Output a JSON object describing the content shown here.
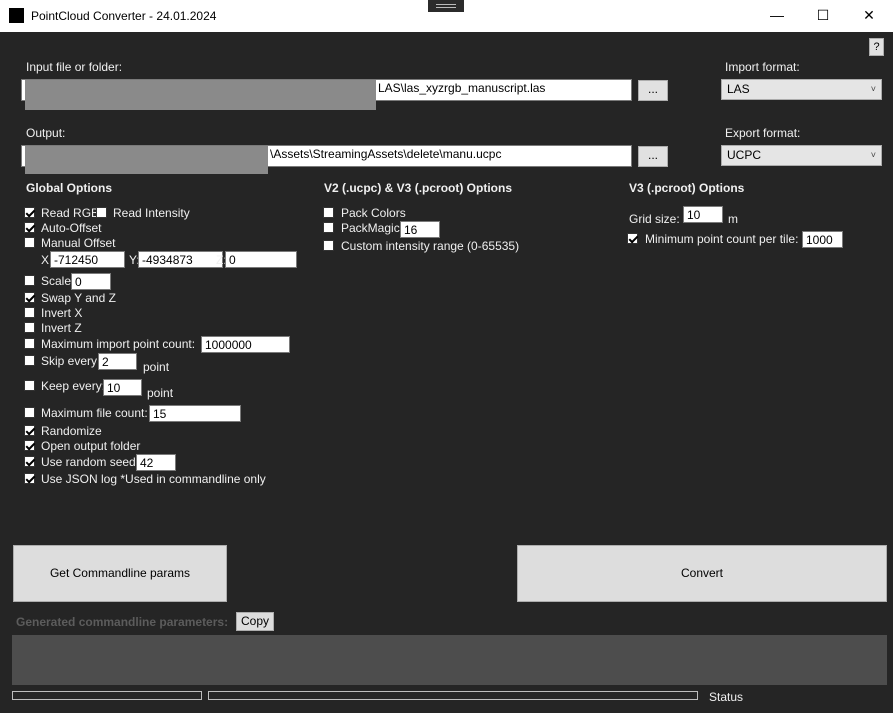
{
  "window": {
    "title": "PointCloud Converter - 24.01.2024",
    "minimize": "—",
    "maximize": "☐",
    "close": "✕"
  },
  "help_button": "?",
  "input": {
    "label": "Input file or folder:",
    "path_visible": "LAS\\las_xyzrgb_manuscript.las",
    "browse": "..."
  },
  "output": {
    "label": "Output:",
    "path_visible": "\\Assets\\StreamingAssets\\delete\\manu.ucpc",
    "browse": "..."
  },
  "import_format": {
    "label": "Import format:",
    "value": "LAS"
  },
  "export_format": {
    "label": "Export format:",
    "value": "UCPC"
  },
  "global_options": {
    "title": "Global Options",
    "read_rgb": {
      "label": "Read RGB",
      "checked": true
    },
    "read_intensity": {
      "label": "Read Intensity",
      "checked": false
    },
    "auto_offset": {
      "label": "Auto-Offset",
      "checked": true
    },
    "manual_offset": {
      "label": "Manual Offset",
      "checked": false
    },
    "offset_x": {
      "label": "X:",
      "value": "-712450"
    },
    "offset_y": {
      "label": "Y:",
      "value": "-4934873"
    },
    "offset_z": {
      "label": "Z:",
      "value": "0"
    },
    "scale": {
      "label": "Scale:",
      "checked": false,
      "value": "0"
    },
    "swap_yz": {
      "label": "Swap Y and Z",
      "checked": true
    },
    "invert_x": {
      "label": "Invert X",
      "checked": false
    },
    "invert_z": {
      "label": "Invert Z",
      "checked": false
    },
    "max_import": {
      "label": "Maximum import point count:",
      "checked": false,
      "value": "1000000"
    },
    "skip_every": {
      "label": "Skip every:",
      "checked": false,
      "value": "2",
      "unit": "point"
    },
    "keep_every": {
      "label": "Keep every:",
      "checked": false,
      "value": "10",
      "unit": "point"
    },
    "max_file_count": {
      "label": "Maximum file count:",
      "checked": false,
      "value": "15"
    },
    "randomize": {
      "label": "Randomize",
      "checked": true
    },
    "open_output": {
      "label": "Open output folder",
      "checked": true
    },
    "random_seed": {
      "label": "Use random seed:",
      "checked": true,
      "value": "42"
    },
    "json_log": {
      "label": "Use JSON log *Used in commandline only",
      "checked": true
    }
  },
  "v2v3_options": {
    "title": "V2 (.ucpc) & V3 (.pcroot) Options",
    "pack_colors": {
      "label": "Pack Colors",
      "checked": false
    },
    "pack_magic": {
      "label": "PackMagic:",
      "checked": false,
      "value": "16"
    },
    "custom_intensity": {
      "label": "Custom intensity range (0-65535)",
      "checked": false
    }
  },
  "v3_options": {
    "title": "V3 (.pcroot) Options",
    "grid_size": {
      "label": "Grid size:",
      "value": "10",
      "unit": "m"
    },
    "min_point_count": {
      "label": "Minimum point count per tile:",
      "checked": true,
      "value": "1000"
    }
  },
  "buttons": {
    "get_params": "Get Commandline params",
    "convert": "Convert",
    "copy": "Copy"
  },
  "generated_label": "Generated commandline parameters:",
  "status": "Status"
}
